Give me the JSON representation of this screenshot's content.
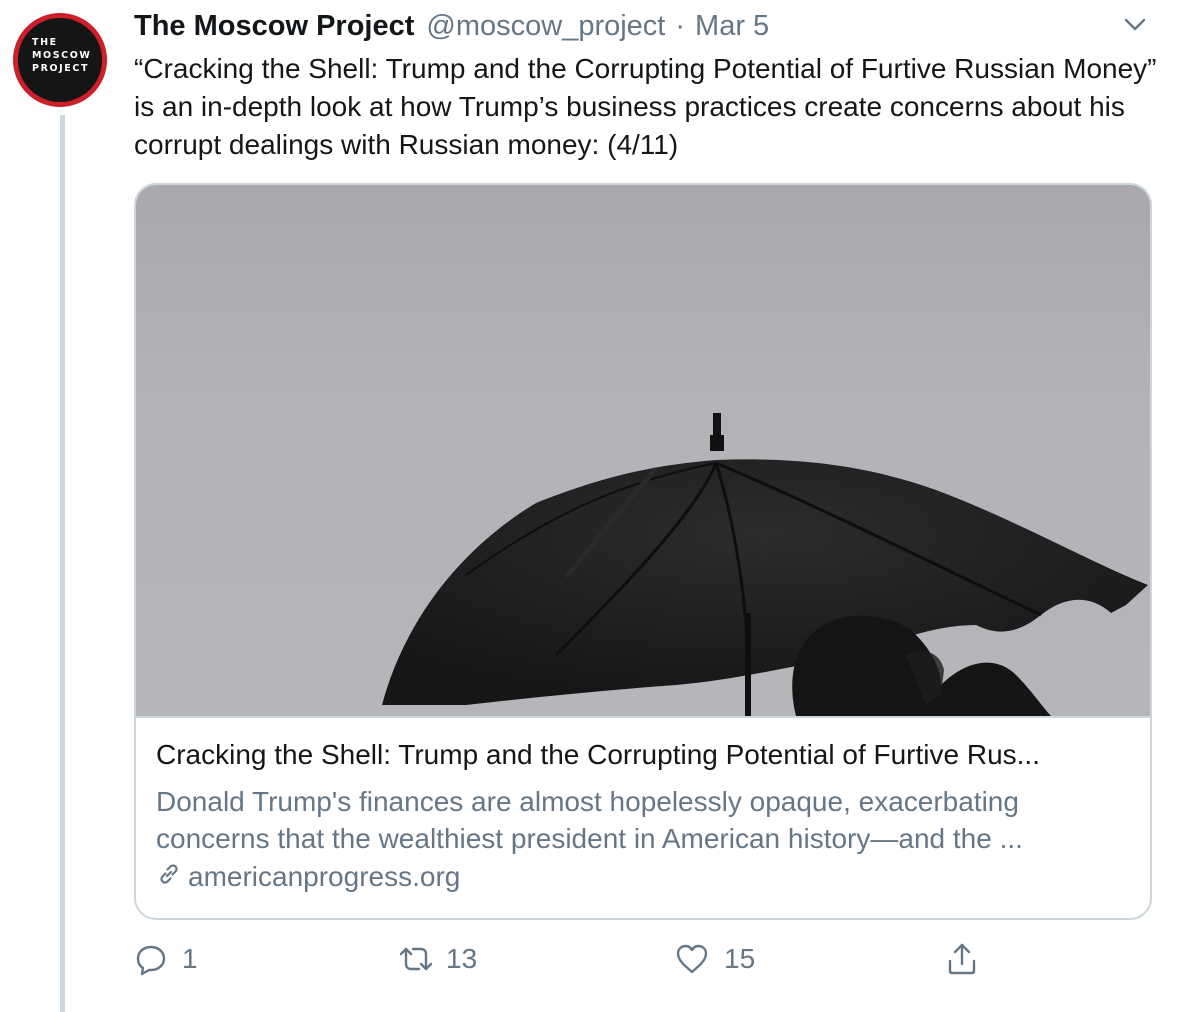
{
  "tweet": {
    "author": {
      "name": "The Moscow Project",
      "handle": "@moscow_project",
      "avatar_text": "THE\nMOSCOW\nPROJECT",
      "avatar_colors": {
        "ring": "#d11f2a",
        "fill": "#151515"
      }
    },
    "separator": "·",
    "date": "Mar 5",
    "menu_icon": "chevron-down-icon",
    "text": "“Cracking the Shell: Trump and the Corrupting Potential of Furtive Russian Money” is an in-depth look at how Trump’s business practices create concerns about his corrupt dealings with Russian money: (4/11)",
    "card": {
      "image_description_icon": "umbrella-photo",
      "title": "Cracking the Shell: Trump and the Corrupting Potential of Furtive Rus...",
      "description": "Donald Trump's finances are almost hopelessly opaque, exacerbating concerns that the wealthiest president in American history—and the ...",
      "domain": "americanprogress.org",
      "link_icon": "link-icon"
    },
    "actions": {
      "replies": {
        "icon": "reply-icon",
        "count": "1"
      },
      "retweets": {
        "icon": "retweet-icon",
        "count": "13"
      },
      "likes": {
        "icon": "heart-icon",
        "count": "15"
      },
      "share": {
        "icon": "share-icon"
      }
    },
    "colors": {
      "text": "#14171a",
      "secondary": "#657786",
      "border": "#ccd6dd",
      "thread_line": "#ccd6dd"
    }
  }
}
